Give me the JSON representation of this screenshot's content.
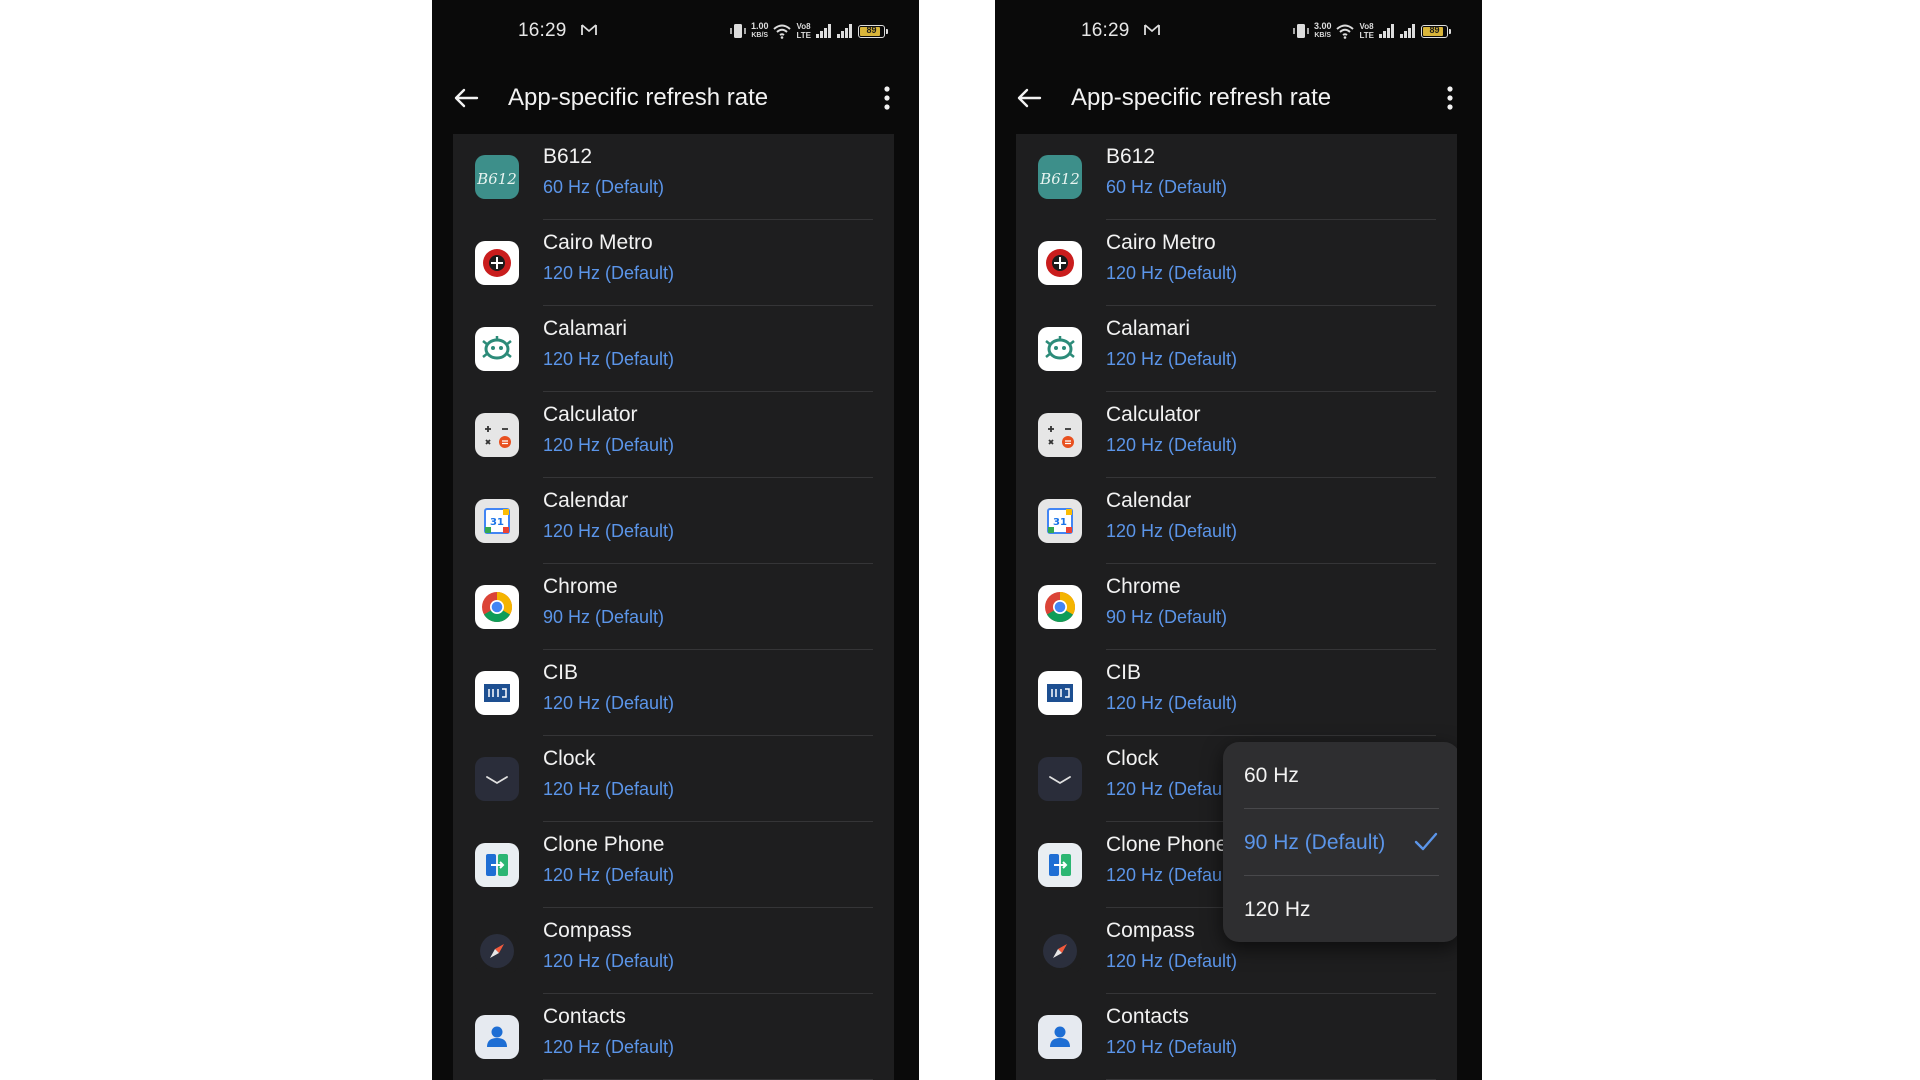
{
  "screens": [
    {
      "status_bar": {
        "time": "16:29",
        "net_speed": "1.00",
        "net_unit": "KB/S",
        "volte_top": "Vo8",
        "volte_bottom": "LTE",
        "battery": "89"
      },
      "app_bar": {
        "title": "App-specific refresh rate"
      },
      "apps": [
        {
          "name": "B612",
          "rate": "60 Hz  (Default)",
          "icon": "b612-icon"
        },
        {
          "name": "Cairo Metro",
          "rate": "120 Hz  (Default)",
          "icon": "cairo-metro-icon"
        },
        {
          "name": "Calamari",
          "rate": "120 Hz  (Default)",
          "icon": "calamari-icon"
        },
        {
          "name": "Calculator",
          "rate": "120 Hz  (Default)",
          "icon": "calculator-icon"
        },
        {
          "name": "Calendar",
          "rate": "120 Hz  (Default)",
          "icon": "calendar-icon"
        },
        {
          "name": "Chrome",
          "rate": "90 Hz  (Default)",
          "icon": "chrome-icon"
        },
        {
          "name": "CIB",
          "rate": "120 Hz  (Default)",
          "icon": "cib-icon"
        },
        {
          "name": "Clock",
          "rate": "120 Hz  (Default)",
          "icon": "clock-icon"
        },
        {
          "name": "Clone Phone",
          "rate": "120 Hz  (Default)",
          "icon": "clone-phone-icon"
        },
        {
          "name": "Compass",
          "rate": "120 Hz  (Default)",
          "icon": "compass-icon"
        },
        {
          "name": "Contacts",
          "rate": "120 Hz  (Default)",
          "icon": "contacts-icon"
        }
      ]
    },
    {
      "status_bar": {
        "time": "16:29",
        "net_speed": "3.00",
        "net_unit": "KB/S",
        "volte_top": "Vo8",
        "volte_bottom": "LTE",
        "battery": "89"
      },
      "app_bar": {
        "title": "App-specific refresh rate"
      },
      "apps": [
        {
          "name": "B612",
          "rate": "60 Hz  (Default)",
          "icon": "b612-icon"
        },
        {
          "name": "Cairo Metro",
          "rate": "120 Hz  (Default)",
          "icon": "cairo-metro-icon"
        },
        {
          "name": "Calamari",
          "rate": "120 Hz  (Default)",
          "icon": "calamari-icon"
        },
        {
          "name": "Calculator",
          "rate": "120 Hz  (Default)",
          "icon": "calculator-icon"
        },
        {
          "name": "Calendar",
          "rate": "120 Hz  (Default)",
          "icon": "calendar-icon"
        },
        {
          "name": "Chrome",
          "rate": "90 Hz  (Default)",
          "icon": "chrome-icon"
        },
        {
          "name": "CIB",
          "rate": "120 Hz  (Default)",
          "icon": "cib-icon"
        },
        {
          "name": "Clock",
          "rate": "120 Hz  (Default)",
          "icon": "clock-icon"
        },
        {
          "name": "Clone Phone",
          "rate": "120 Hz  (Default)",
          "icon": "clone-phone-icon"
        },
        {
          "name": "Compass",
          "rate": "120 Hz  (Default)",
          "icon": "compass-icon"
        },
        {
          "name": "Contacts",
          "rate": "120 Hz  (Default)",
          "icon": "contacts-icon"
        }
      ],
      "popup": {
        "options": [
          {
            "label": "60 Hz",
            "selected": false
          },
          {
            "label": "90 Hz  (Default)",
            "selected": true
          },
          {
            "label": "120 Hz",
            "selected": false
          }
        ]
      }
    }
  ],
  "colors": {
    "accent": "#5b95e9",
    "card": "#1e1e1f",
    "background": "#0a0a0a",
    "popup": "#2e2e30"
  }
}
